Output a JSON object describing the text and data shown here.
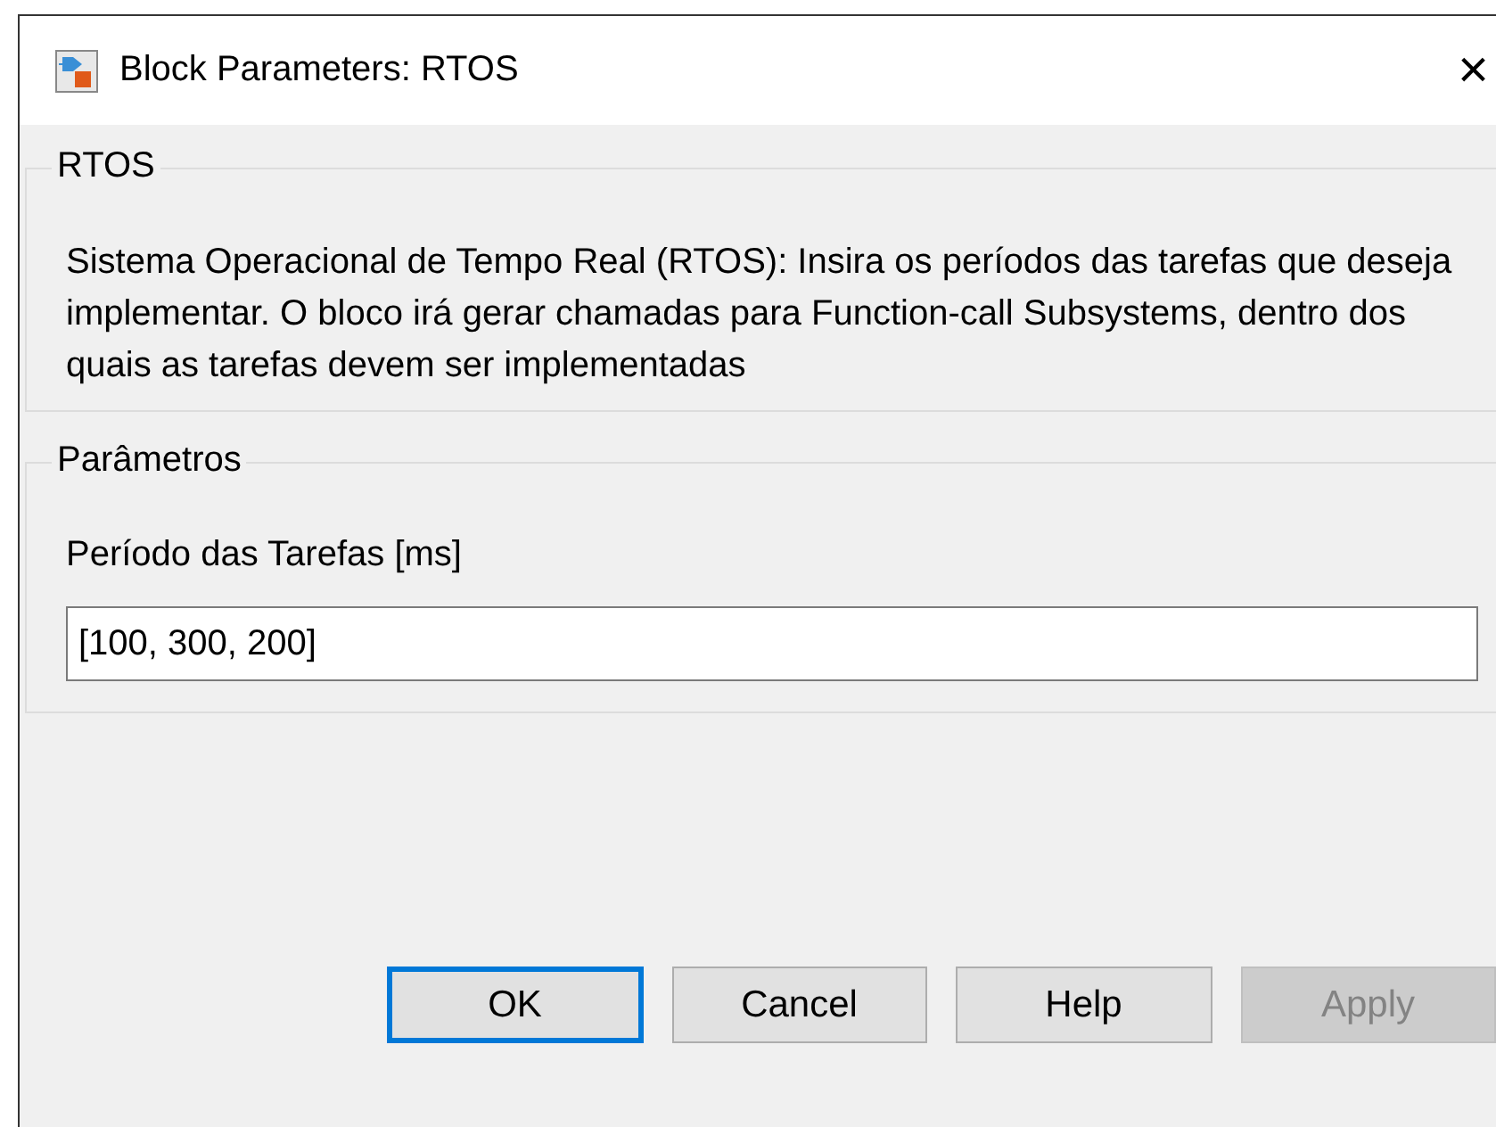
{
  "window": {
    "title": "Block Parameters: RTOS",
    "close": "×"
  },
  "description_group": {
    "title": "RTOS",
    "text": "Sistema Operacional de Tempo Real (RTOS): Insira os períodos das tarefas que deseja implementar. O bloco irá gerar chamadas para Function-call Subsystems, dentro dos quais as tarefas devem ser implementadas"
  },
  "parameters_group": {
    "title": "Parâmetros",
    "fields": [
      {
        "label": "Período das Tarefas [ms]",
        "value": "[100, 300, 200]"
      }
    ]
  },
  "buttons": [
    {
      "label": "OK",
      "focused": true,
      "disabled": false
    },
    {
      "label": "Cancel",
      "focused": false,
      "disabled": false
    },
    {
      "label": "Help",
      "focused": false,
      "disabled": false
    },
    {
      "label": "Apply",
      "focused": false,
      "disabled": true
    }
  ]
}
